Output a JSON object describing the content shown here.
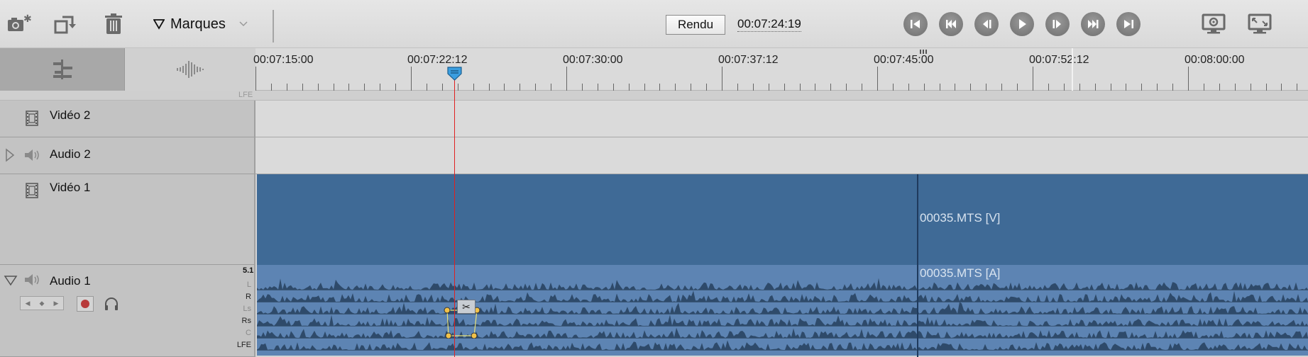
{
  "toolbar": {
    "marks_label": "Marques",
    "render_label": "Rendu",
    "timecode": "00:07:24:19",
    "tools": [
      "camera-settings-icon",
      "rotate-icon",
      "trash-icon"
    ],
    "transport": [
      "go-to-start-icon",
      "previous-edit-icon",
      "step-back-icon",
      "play-icon",
      "step-forward-icon",
      "next-edit-icon",
      "go-to-end-icon"
    ],
    "right_tools": [
      "monitor-settings-icon",
      "fullscreen-icon"
    ]
  },
  "ruler": {
    "labels": [
      "00:07:15:00",
      "00:07:22:12",
      "00:07:30:00",
      "00:07:37:12",
      "00:07:45:00",
      "00:07:52:12",
      "00:08:00:00"
    ]
  },
  "lfe_label": "LFE",
  "tracks": {
    "video2": "Vidéo 2",
    "audio2": "Audio 2",
    "video1": "Vidéo 1",
    "audio1": "Audio 1"
  },
  "clips": {
    "video": "00035.MTS [V]",
    "audio": "00035.MTS [A]"
  },
  "channel_format": "5.1",
  "channels": [
    "L",
    "R",
    "Ls",
    "Rs",
    "C",
    "LFE"
  ],
  "colors": {
    "video_clip": "#3f6a96",
    "audio_clip": "#5d84b3",
    "playhead": "#e02020",
    "waveform": "#2e4a6a"
  }
}
